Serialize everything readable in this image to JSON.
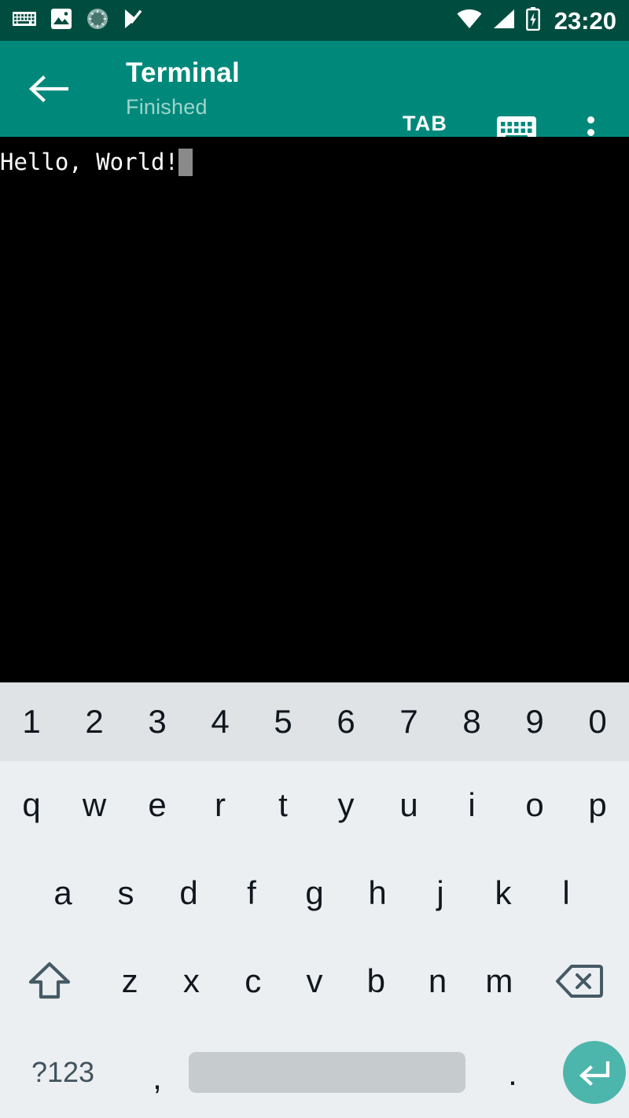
{
  "status_bar": {
    "background": "#004D40",
    "time": "23:20",
    "left_icons": [
      {
        "name": "keyboard-status-icon",
        "label": "keyboard"
      },
      {
        "name": "image-status-icon",
        "label": "photo"
      },
      {
        "name": "sync-spinner-status-icon",
        "label": "sync-spinner"
      },
      {
        "name": "task-check-status-icon",
        "label": "task-check"
      }
    ],
    "right_icons": [
      {
        "name": "wifi-icon",
        "label": "wifi"
      },
      {
        "name": "cellular-signal-icon",
        "label": "signal"
      },
      {
        "name": "battery-charging-icon",
        "label": "battery-charging"
      }
    ]
  },
  "app_bar": {
    "background": "#00897B",
    "back_label": "back",
    "title": "Terminal",
    "subtitle": "Finished",
    "tab_label": "TAB",
    "keyboard_toggle_label": "keyboard",
    "overflow_label": "more options"
  },
  "terminal": {
    "background": "#000000",
    "text_color": "#FFFFFF",
    "cursor_color": "#8A8A8A",
    "output": "Hello, World!"
  },
  "keyboard": {
    "background": "#ECEFF1",
    "number_row_background": "#DFE3E6",
    "accent": "#4DB6AC",
    "space_key_color": "#C6CBCE",
    "number_row": [
      "1",
      "2",
      "3",
      "4",
      "5",
      "6",
      "7",
      "8",
      "9",
      "0"
    ],
    "row_qwerty": [
      "q",
      "w",
      "e",
      "r",
      "t",
      "y",
      "u",
      "i",
      "o",
      "p"
    ],
    "row_asdf": [
      "a",
      "s",
      "d",
      "f",
      "g",
      "h",
      "j",
      "k",
      "l"
    ],
    "row_zxcv": [
      "z",
      "x",
      "c",
      "v",
      "b",
      "n",
      "m"
    ],
    "shift_label": "shift",
    "backspace_label": "backspace",
    "bottom_row": {
      "symbols_label": "?123",
      "comma_label": ",",
      "space_label": "space",
      "period_label": ".",
      "enter_label": "enter"
    }
  }
}
